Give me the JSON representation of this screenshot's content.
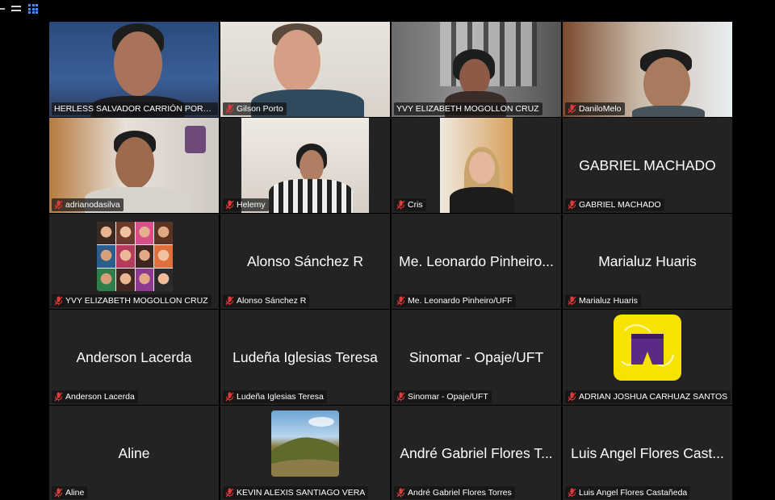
{
  "colors": {
    "active_speaker_border": "#2dbe3c",
    "gallery_icon": "#4a8cf0",
    "muted_mic": "#e03b3b",
    "tile_bg": "#232323"
  },
  "toolbar": {
    "icons": [
      "minimize-icon",
      "speaker-view-icon",
      "gallery-view-icon"
    ]
  },
  "participants": [
    {
      "label": "HERLESS SALVADOR CARRIÓN PORTIL...",
      "video": true
    },
    {
      "label": "Gilson Porto",
      "video": true
    },
    {
      "label": "YVY ELIZABETH MOGOLLON CRUZ",
      "video": true
    },
    {
      "label": "DaniloMelo",
      "video": true
    },
    {
      "label": "adrianodasilva",
      "video": true
    },
    {
      "label": "Helemy",
      "video": true
    },
    {
      "label": "Cris",
      "video": true
    },
    {
      "label": "GABRIEL MACHADO",
      "big": "GABRIEL MACHADO"
    },
    {
      "label": "YVY ELIZABETH MOGOLLON CRUZ",
      "avatar": "collage"
    },
    {
      "label": "Alonso Sánchez R",
      "big": "Alonso Sánchez R"
    },
    {
      "label": "Me. Leonardo Pinheiro/UFF",
      "big": "Me. Leonardo Pinheiro..."
    },
    {
      "label": "Marialuz Huaris",
      "big": "Marialuz Huaris"
    },
    {
      "label": "Anderson Lacerda",
      "big": "Anderson Lacerda"
    },
    {
      "label": "Ludeña Iglesias Teresa",
      "big": "Ludeña Iglesias Teresa"
    },
    {
      "label": "Sinomar - Opaje/UFT",
      "big": "Sinomar - Opaje/UFT"
    },
    {
      "label": "ADRIAN JOSHUA CARHUAZ SANTOS",
      "avatar": "yellow-logo"
    },
    {
      "label": "Aline",
      "big": "Aline"
    },
    {
      "label": "KEVIN ALEXIS SANTIAGO VERA",
      "avatar": "landscape"
    },
    {
      "label": "André Gabriel Flores Torres",
      "big": "André Gabriel Flores T..."
    },
    {
      "label": "Luis Angel Flores Castañeda",
      "big": "Luis Angel Flores Cast..."
    }
  ]
}
